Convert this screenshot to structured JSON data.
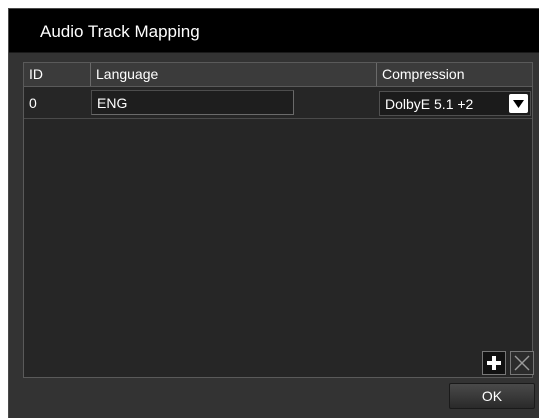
{
  "dialog": {
    "title": "Audio Track Mapping"
  },
  "table": {
    "columns": [
      "ID",
      "Language",
      "Compression"
    ],
    "rows": [
      {
        "id": "0",
        "language": "ENG",
        "compression": "DolbyE 5.1 +2"
      }
    ]
  },
  "icons": {
    "add": "plus-icon",
    "remove": "cross-icon",
    "dropdown": "chevron-down-icon"
  },
  "buttons": {
    "ok_label": "OK"
  }
}
